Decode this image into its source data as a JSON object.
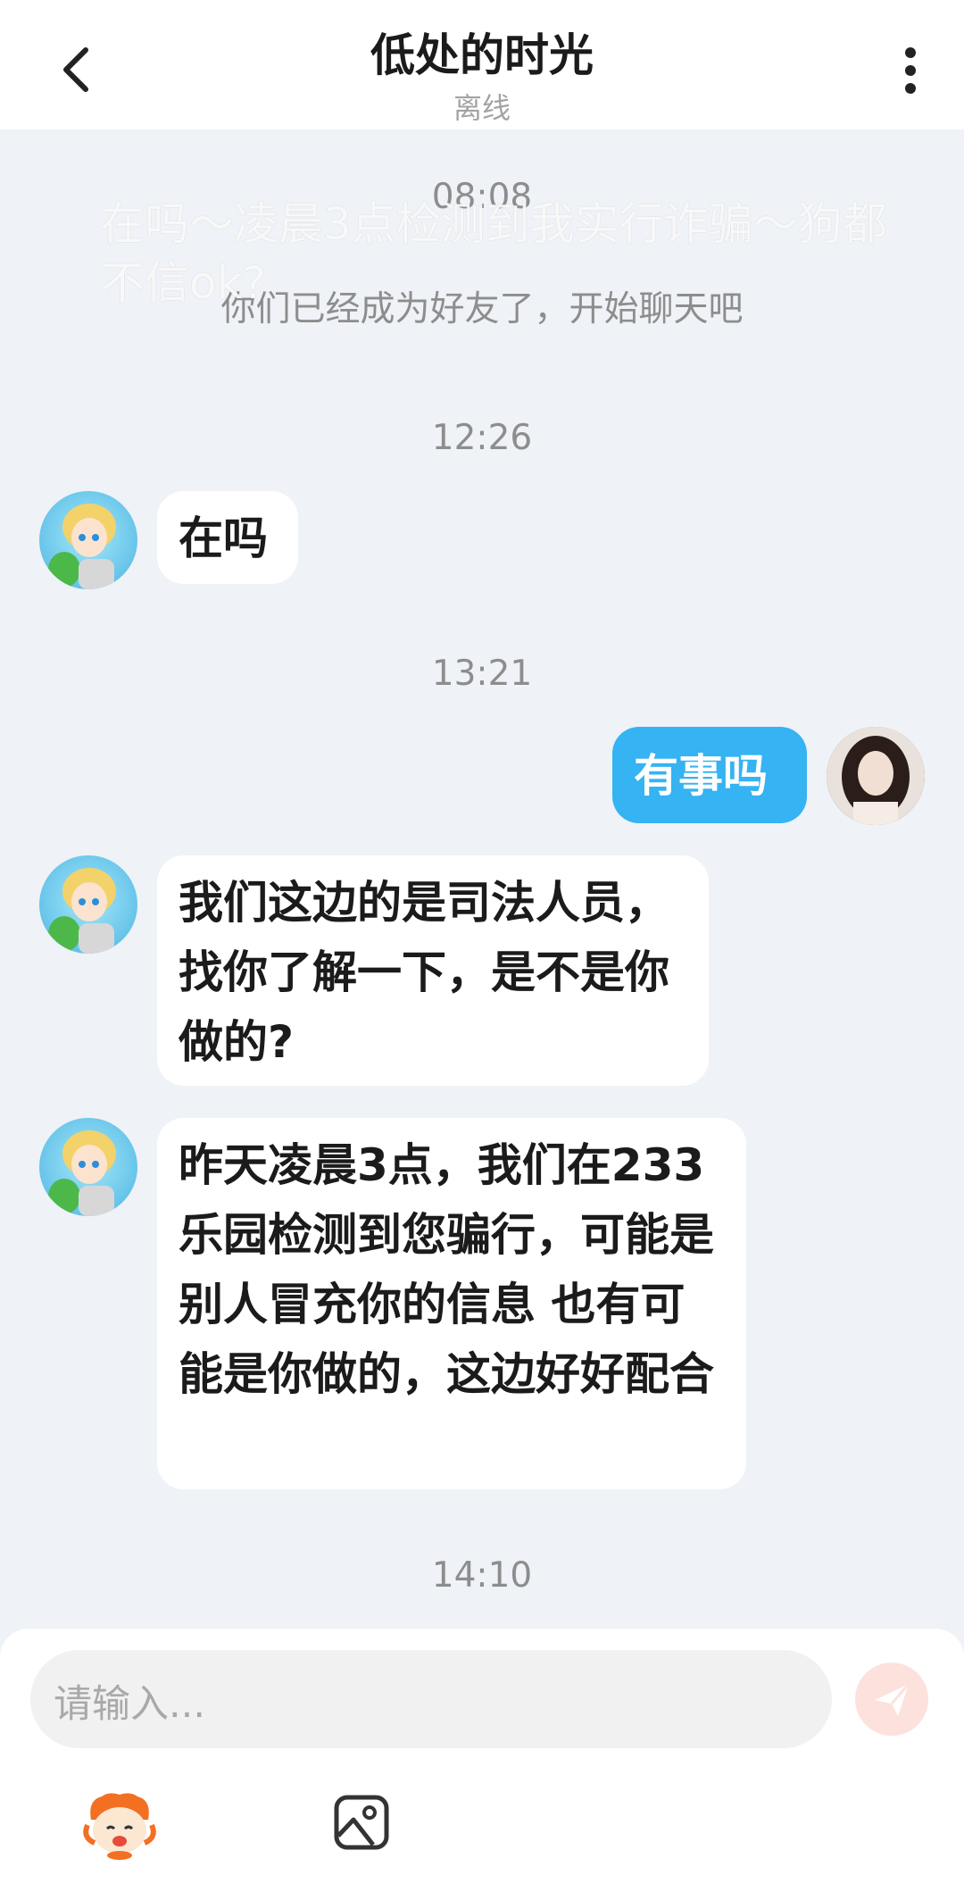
{
  "header": {
    "title": "低处的时光",
    "status": "离线",
    "back_icon": "chevron-left-icon",
    "more_icon": "more-vertical-icon"
  },
  "watermark": "在吗～凌晨3点检测到我实行诈骗～狗都不信ok?",
  "messages": {
    "time_0808": "08:08",
    "system_text": "你们已经成为好友了，开始聊天吧",
    "time_1226": "12:26",
    "msg1": "在吗",
    "time_1321": "13:21",
    "msg2": "有事吗",
    "msg3": "我们这边的是司法人员，找你了解一下，是不是你做的?",
    "msg4": "昨天凌晨3点，我们在233乐园检测到您骗行，可能是别人冒充你的信息 也有可能是你做的，这边好好配合",
    "time_1410": "14:10"
  },
  "input": {
    "placeholder": "请输入...",
    "send_icon": "send-icon",
    "emoji_icon": "emoji-mascot-icon",
    "image_icon": "image-icon"
  },
  "colors": {
    "background": "#eff2f6",
    "self_bubble": "#35b3f3",
    "other_bubble": "#ffffff",
    "send_button": "#fde1dd"
  }
}
